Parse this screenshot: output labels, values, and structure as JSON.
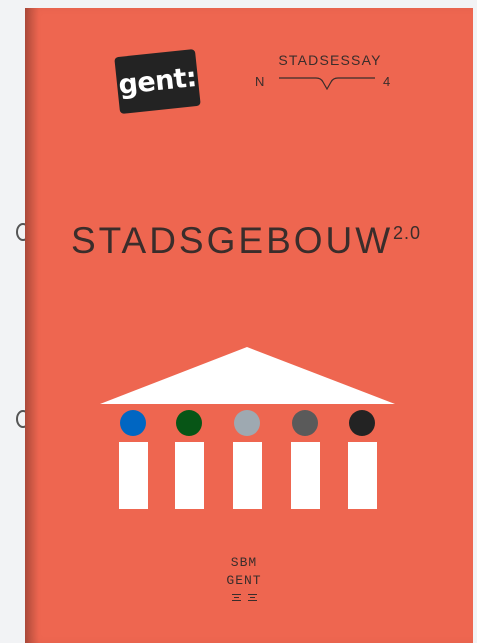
{
  "cover": {
    "background_color": "#ee6650",
    "logo_text": "gent:",
    "series_title": "STADSESSAY",
    "series_prefix": "N",
    "series_number": "4",
    "title": "STADSGEBOUW",
    "version": "2.0",
    "publisher_line_1": "SBM",
    "publisher_line_2": "GENT"
  },
  "colors": {
    "text": "#3a2d2b",
    "logo_bg": "#232323",
    "building": "#ffffff",
    "dot_1": "#0066c2",
    "dot_2": "#075516",
    "dot_3": "#9ea9b1",
    "dot_4": "#5a5a5a",
    "dot_5": "#232323"
  },
  "icons": {
    "binder_rings": "binder-ring-icon",
    "building": "building-icon",
    "brace": "brace-icon"
  }
}
